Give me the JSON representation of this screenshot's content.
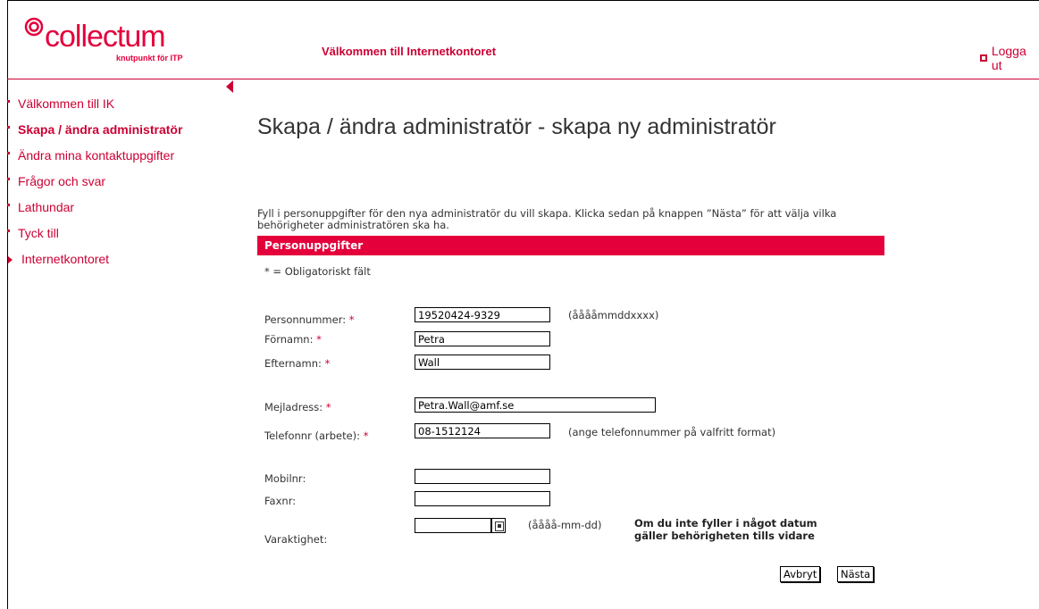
{
  "header": {
    "logo_text": "collectum",
    "logo_tagline": "knutpunkt för ITP",
    "welcome": "Välkommen till Internetkontoret",
    "logout": "Logga ut"
  },
  "sidebar": {
    "items": [
      {
        "label": "Välkommen till IK"
      },
      {
        "label": "Skapa / ändra administratör"
      },
      {
        "label": "Ändra mina kontaktuppgifter"
      },
      {
        "label": "Frågor och svar"
      },
      {
        "label": "Lathundar"
      },
      {
        "label": "Tyck till"
      },
      {
        "label": "Internetkontoret"
      }
    ]
  },
  "main": {
    "title": "Skapa / ändra administratör - skapa ny administratör",
    "intro": "Fyll i personuppgifter för den nya administratör du vill skapa. Klicka sedan på knappen ”Nästa” för att välja vilka behörigheter administratören ska ha.",
    "section": "Personuppgifter",
    "required_note": "* = Obligatoriskt fält"
  },
  "form": {
    "personnummer": {
      "label": "Personnummer:",
      "value": "19520424-9329",
      "hint": "(ååååmmddxxxx)"
    },
    "fornamn": {
      "label": "Förnamn:",
      "value": "Petra"
    },
    "efternamn": {
      "label": "Efternamn:",
      "value": "Wall"
    },
    "mejl": {
      "label": "Mejladress:",
      "value": "Petra.Wall@amf.se"
    },
    "telefon": {
      "label": "Telefonnr (arbete):",
      "value": "08-1512124",
      "hint": "(ange telefonnummer på valfritt format)"
    },
    "mobil": {
      "label": "Mobilnr:",
      "value": ""
    },
    "fax": {
      "label": "Faxnr:",
      "value": ""
    },
    "varaktighet": {
      "label": "Varaktighet:",
      "value": "",
      "hint": "(åååå-mm-dd)",
      "note_line1": "Om du inte fyller i något datum",
      "note_line2": "gäller behörigheten tills vidare"
    },
    "required_mark": "*"
  },
  "buttons": {
    "cancel": "Avbryt",
    "next": "Nästa"
  }
}
